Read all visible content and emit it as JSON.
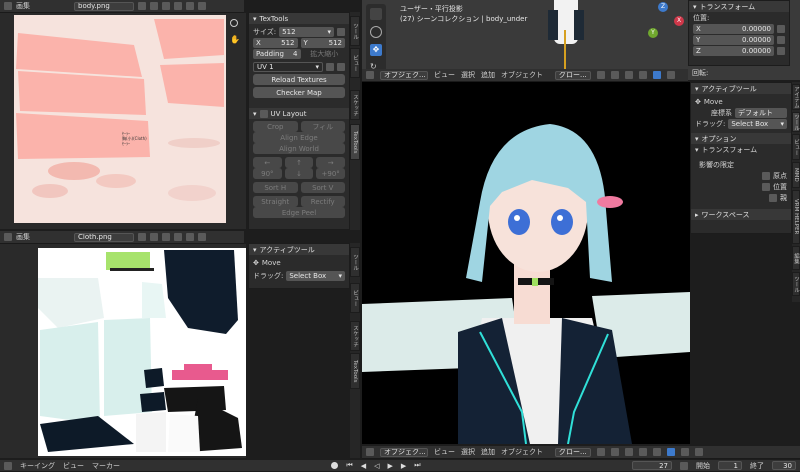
{
  "top_uv_editor": {
    "mode_label": "画集",
    "image_name": "body.png",
    "panel_title": "TexTools",
    "size_label": "サイズ:",
    "size_value": "512",
    "x_label": "X",
    "x_value": "512",
    "y_label": "Y",
    "y_value": "512",
    "padding_label": "Padding",
    "padding_value": "4",
    "disabled_text": "拡大縮小",
    "uv_channel": "UV 1",
    "reload_textures": "Reload Textures",
    "checker_map": "Checker Map",
    "uv_layout_title": "UV Layout",
    "crop": "Crop",
    "fill": "フィル",
    "align_edge": "Align Edge",
    "align_world": "Align World",
    "rot90_left": "90°",
    "rot90_right": "+90°",
    "sort_h": "Sort H",
    "sort_v": "Sort V",
    "straight": "Straight",
    "rectify": "Rectify",
    "edge_peel": "Edge Peel",
    "texture_annotation": "ｾｰﾗｰ\n胸(小)(Cloth)\nｾｰﾗｰ",
    "side_tabs": [
      "TexTools",
      "スケッチ",
      "ビュー",
      "ツール"
    ]
  },
  "bottom_uv_editor": {
    "mode_label": "画集",
    "image_name": "Cloth.png",
    "panel_title": "アクティブツール",
    "move": "Move",
    "drag_label": "ドラッグ:",
    "drag_value": "Select Box",
    "side_tabs": [
      "TexTools",
      "スケッチ",
      "ビュー",
      "ツール"
    ]
  },
  "viewport_top": {
    "title_line1": "ユーザー・平行投影",
    "title_line2": "(27) シーンコレクション | body_under",
    "menu": [
      "オブジェク...",
      "ビュー",
      "選択",
      "追加",
      "オブジェクト"
    ],
    "transform_panel": {
      "title": "トランスフォーム",
      "location_label": "位置:",
      "x_label": "X",
      "x": "0.00000",
      "y_label": "Y",
      "y": "0.00000",
      "z_label": "Z",
      "z": "0.00000",
      "rotation_label": "回転:"
    },
    "gizmo_labels": [
      "Z",
      "X",
      "Y"
    ]
  },
  "viewport_main": {
    "tool_panel": {
      "title": "アクティブツール",
      "move": "Move",
      "coord_label": "座標系",
      "coord_value": "デフォルト",
      "drag_label": "ドラッグ:",
      "drag_value": "Select Box",
      "options_title": "オプション",
      "transform_title": "トランスフォーム",
      "affect_only": "影響の限定",
      "origins": "原点",
      "locations": "位置",
      "parents": "親",
      "workspace": "ワークスペース"
    },
    "side_tabs": [
      "アイテム",
      "ツール",
      "ビュー",
      "MMD",
      "VRM HELPER",
      "編集",
      "ツール"
    ],
    "shading_label": "グロー..."
  },
  "viewport_bottom_header": {
    "menu": [
      "オブジェク...",
      "ビュー",
      "選択",
      "追加",
      "オブジェクト"
    ],
    "shading_label": "グロー..."
  },
  "timeline": {
    "menu": [
      "キーイング",
      "ビュー",
      "マーカー"
    ],
    "current_frame": "27",
    "start_label": "開始",
    "start_value": "1",
    "end_label": "終了",
    "end_value": "30"
  },
  "colors": {
    "skin_texture": "#f6e3dd",
    "uv_island": "#fbb3ab",
    "background": "#1d1d1d",
    "panel": "#2b2b2b",
    "accent_blue": "#3d7acc"
  }
}
